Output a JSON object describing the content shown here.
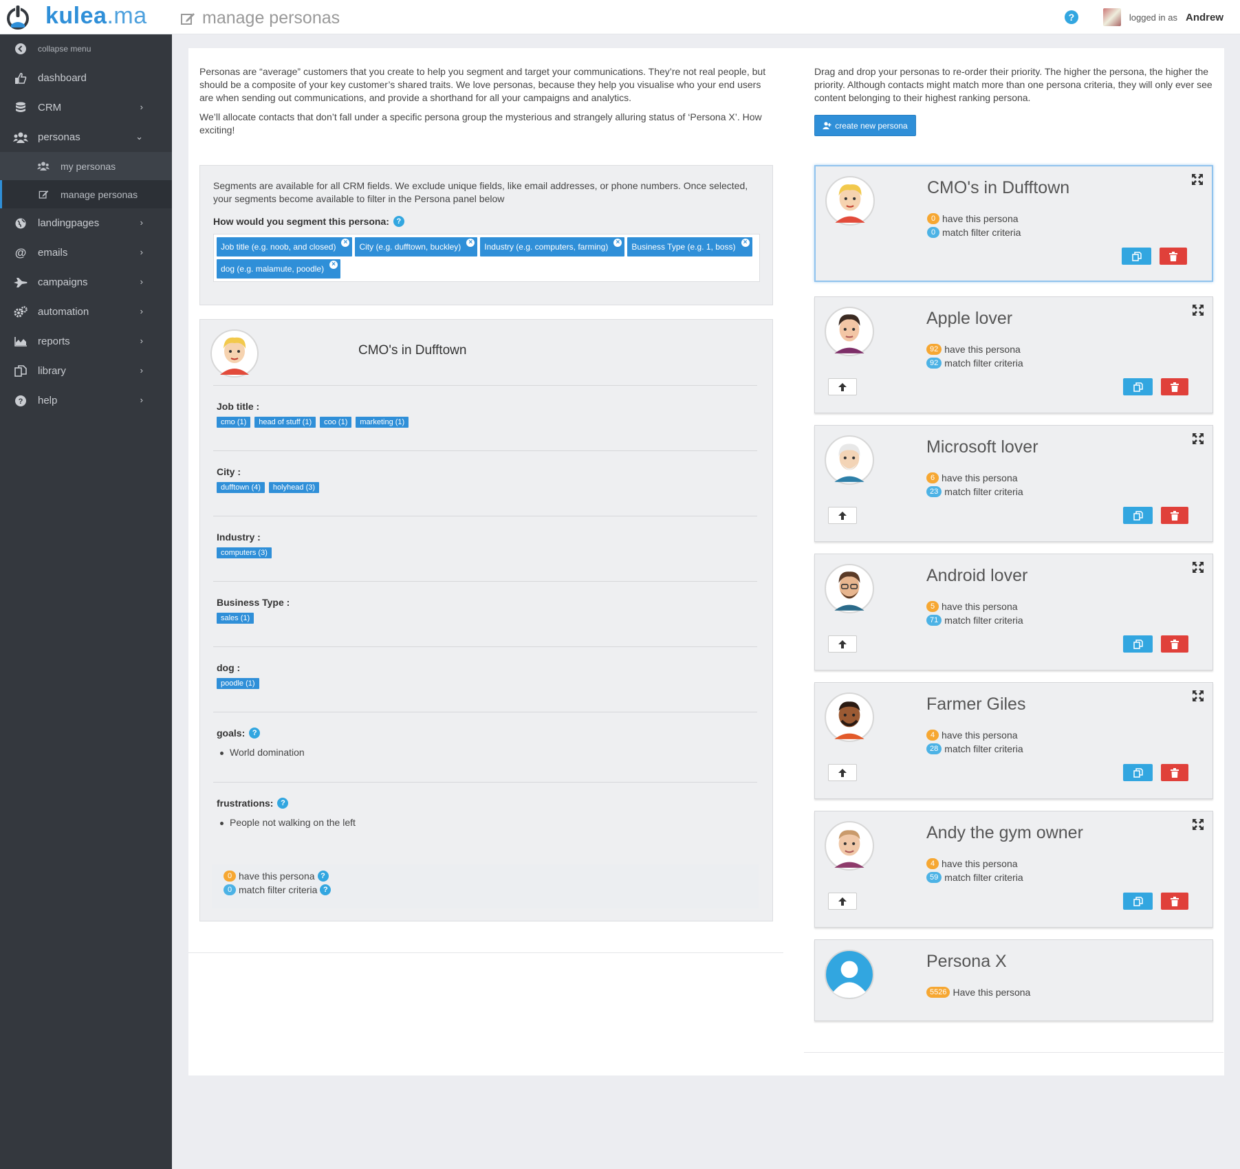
{
  "app": {
    "brand_main": "kulea",
    "brand_tld": ".ma"
  },
  "header": {
    "page_title": "manage personas",
    "logged_in_label": "logged in as",
    "user_name": "Andrew"
  },
  "sidebar": {
    "collapse": "collapse menu",
    "items": [
      {
        "label": "dashboard",
        "icon": "thumbs-up-icon"
      },
      {
        "label": "CRM",
        "icon": "database-icon"
      },
      {
        "label": "personas",
        "icon": "users-icon"
      },
      {
        "label": "my personas",
        "icon": "users-icon"
      },
      {
        "label": "manage personas",
        "icon": "edit-icon"
      },
      {
        "label": "landingpages",
        "icon": "globe-icon"
      },
      {
        "label": "emails",
        "icon": "at-icon"
      },
      {
        "label": "campaigns",
        "icon": "plane-icon"
      },
      {
        "label": "automation",
        "icon": "cogs-icon"
      },
      {
        "label": "reports",
        "icon": "area-chart-icon"
      },
      {
        "label": "library",
        "icon": "files-icon"
      },
      {
        "label": "help",
        "icon": "question-icon"
      }
    ]
  },
  "intro": {
    "p1": "Personas are “average” customers that you create to help you segment and target your communications. They’re not real people, but should be a composite of your key customer’s shared traits. We love personas, because they help you visualise who your end users are when sending out communications, and provide a shorthand for all your campaigns and analytics.",
    "p2": "We’ll allocate contacts that don’t fall under a specific persona group the mysterious and strangely alluring status of ‘Persona X’. How exciting!"
  },
  "right_intro": "Drag and drop your personas to re-order their priority. The higher the persona, the higher the priority. Although contacts might match more than one persona criteria, they will only ever see content belonging to their highest ranking persona.",
  "create_button": "create new persona",
  "segments": {
    "text": "Segments are available for all CRM fields. We exclude unique fields, like email addresses, or phone numbers. Once selected, your segments become available to filter in the Persona panel below",
    "question": "How would you segment this persona:",
    "tags": [
      "Job title (e.g. noob, and closed)",
      "City (e.g. dufftown, buckley)",
      "Industry (e.g. computers, farming)",
      "Business Type (e.g. 1, boss)",
      "dog (e.g. malamute, poodle)"
    ]
  },
  "detail": {
    "name": "CMO's in Dufftown",
    "job_title": {
      "label": "Job title :",
      "tags": [
        "cmo (1)",
        "head of stuff (1)",
        "coo (1)",
        "marketing (1)"
      ]
    },
    "city": {
      "label": "City :",
      "tags": [
        "dufftown (4)",
        "holyhead (3)"
      ]
    },
    "industry": {
      "label": "Industry :",
      "tags": [
        "computers (3)"
      ]
    },
    "business_type": {
      "label": "Business Type :",
      "tags": [
        "sales (1)"
      ]
    },
    "dog": {
      "label": "dog :",
      "tags": [
        "poodle (1)"
      ]
    },
    "goals": {
      "label": "goals:",
      "items": [
        "World domination"
      ]
    },
    "frustrations": {
      "label": "frustrations:",
      "items": [
        "People not walking on the left"
      ]
    },
    "have_count": "0",
    "have_label": "have this persona",
    "match_count": "0",
    "match_label": "match filter criteria"
  },
  "personas": [
    {
      "name": "CMO's in Dufftown",
      "have": "0",
      "match": "0"
    },
    {
      "name": "Apple lover",
      "have": "92",
      "match": "92"
    },
    {
      "name": "Microsoft lover",
      "have": "6",
      "match": "23"
    },
    {
      "name": "Android lover",
      "have": "5",
      "match": "71"
    },
    {
      "name": "Farmer Giles",
      "have": "4",
      "match": "28"
    },
    {
      "name": "Andy the gym owner",
      "have": "4",
      "match": "59"
    }
  ],
  "persona_labels": {
    "have": "have this persona",
    "match": "match filter criteria"
  },
  "persona_x": {
    "name": "Persona X",
    "count": "5526",
    "label": "Have this persona"
  },
  "colors": {
    "primary": "#2f8fd8",
    "sidebar": "#34383e",
    "orange": "#f6a732",
    "light_blue": "#4cb2e5",
    "danger": "#e0403a"
  }
}
